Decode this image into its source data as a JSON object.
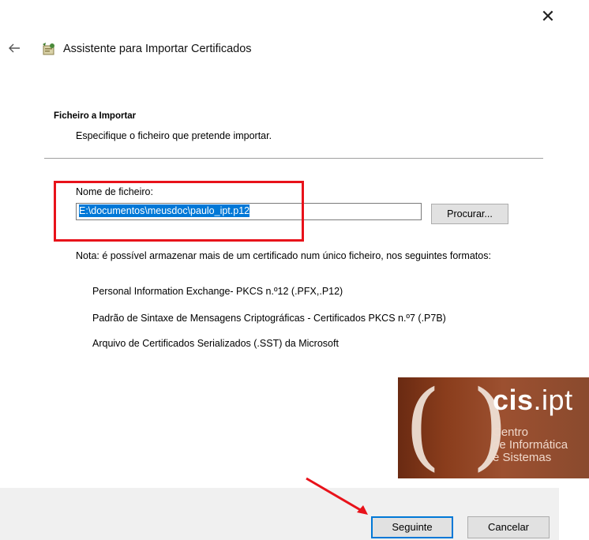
{
  "window": {
    "title": "Assistente para Importar Certificados",
    "close_icon": "close-icon",
    "back_icon": "back-arrow-icon",
    "wizard_icon": "certificate-wizard-icon"
  },
  "section": {
    "title": "Ficheiro a Importar",
    "subtitle": "Especifique o ficheiro que pretende importar."
  },
  "file": {
    "label": "Nome de ficheiro:",
    "value": "E:\\documentos\\meusdoc\\paulo_ipt.p12",
    "browse_label": "Procurar..."
  },
  "note": {
    "text": "Nota: é possível armazenar mais de um certificado num único ficheiro, nos seguintes formatos:",
    "formats": [
      "Personal Information Exchange- PKCS n.º12 (.PFX,.P12)",
      "Padrão de Sintaxe de Mensagens Criptográficas - Certificados PKCS n.º7 (.P7B)",
      "Arquivo de Certificados Serializados (.SST) da Microsoft"
    ]
  },
  "logo": {
    "brand_bold": "cis",
    "brand_rest": ".ipt",
    "lines": [
      "Centro",
      "de Informática",
      "e Sistemas"
    ]
  },
  "buttons": {
    "next": "Seguinte",
    "cancel": "Cancelar"
  },
  "colors": {
    "highlight": "#e8121a",
    "selection": "#0078d7"
  }
}
